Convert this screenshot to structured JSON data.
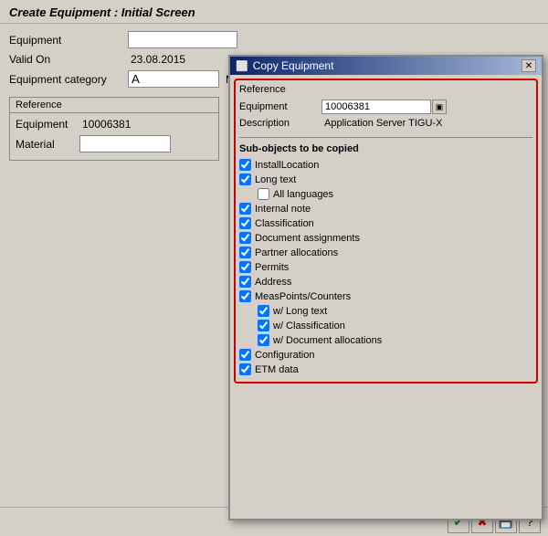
{
  "window": {
    "title": "Create Equipment : Initial Screen"
  },
  "main_form": {
    "equipment_label": "Equipment",
    "equipment_value": "",
    "valid_on_label": "Valid On",
    "valid_on_value": "23.08.2015",
    "equipment_category_label": "Equipment category",
    "equipment_category_code": "A",
    "equipment_category_name": "Machines",
    "reference_box_title": "Reference",
    "ref_equipment_label": "Equipment",
    "ref_equipment_value": "10006381",
    "ref_material_label": "Material",
    "ref_material_value": ""
  },
  "dialog": {
    "title": "Copy Equipment",
    "title_icon": "⬜",
    "reference_section_title": "Reference",
    "equipment_label": "Equipment",
    "equipment_value": "10006381",
    "description_label": "Description",
    "description_value": "Application Server TIGU-X",
    "subobjects_title": "Sub-objects to be copied",
    "checkboxes": [
      {
        "id": "installLocation",
        "label": "InstallLocation",
        "checked": true,
        "indented": 0
      },
      {
        "id": "longText",
        "label": "Long text",
        "checked": true,
        "indented": 0
      },
      {
        "id": "allLanguages",
        "label": "All languages",
        "checked": false,
        "indented": 1
      },
      {
        "id": "internalNote",
        "label": "Internal note",
        "checked": true,
        "indented": 0
      },
      {
        "id": "classification",
        "label": "Classification",
        "checked": true,
        "indented": 0
      },
      {
        "id": "documentAssignments",
        "label": "Document assignments",
        "checked": true,
        "indented": 0
      },
      {
        "id": "partnerAllocations",
        "label": "Partner allocations",
        "checked": true,
        "indented": 0
      },
      {
        "id": "permits",
        "label": "Permits",
        "checked": true,
        "indented": 0
      },
      {
        "id": "address",
        "label": "Address",
        "checked": true,
        "indented": 0
      },
      {
        "id": "measPoints",
        "label": "MeasPoints/Counters",
        "checked": true,
        "indented": 0
      },
      {
        "id": "wLongText",
        "label": "w/ Long text",
        "checked": true,
        "indented": 1
      },
      {
        "id": "wClassification",
        "label": "w/ Classification",
        "checked": true,
        "indented": 1
      },
      {
        "id": "wDocumentAllocations",
        "label": "w/ Document allocations",
        "checked": true,
        "indented": 1
      },
      {
        "id": "configuration",
        "label": "Configuration",
        "checked": true,
        "indented": 0
      },
      {
        "id": "etmData",
        "label": "ETM data",
        "checked": true,
        "indented": 0
      }
    ]
  },
  "toolbar": {
    "confirm_label": "✔",
    "cancel_label": "✖",
    "save_label": "💾",
    "help_label": "?"
  }
}
